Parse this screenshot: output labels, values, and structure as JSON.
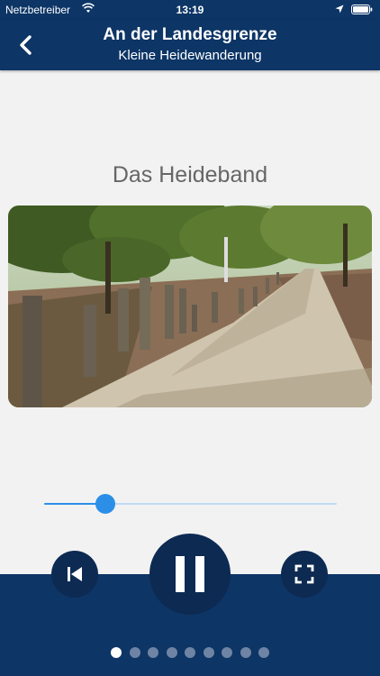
{
  "status_bar": {
    "carrier": "Netzbetreiber",
    "time": "13:19"
  },
  "nav": {
    "title": "An der Landesgrenze",
    "subtitle": "Kleine Heidewanderung",
    "back_icon": "chevron-left-icon"
  },
  "content": {
    "heading": "Das Heideband",
    "image_description": "heath path with wooden posts"
  },
  "player": {
    "progress_fraction": 0.21,
    "state": "playing",
    "prev_icon": "skip-back-icon",
    "play_pause_icon": "pause-icon",
    "fullscreen_icon": "fullscreen-icon"
  },
  "pagination": {
    "total": 9,
    "active_index": 0
  },
  "colors": {
    "header": "#0d3566",
    "panel": "#0d3566",
    "button": "#0d2a52",
    "accent": "#2b8fe8",
    "background": "#f2f2f2"
  }
}
